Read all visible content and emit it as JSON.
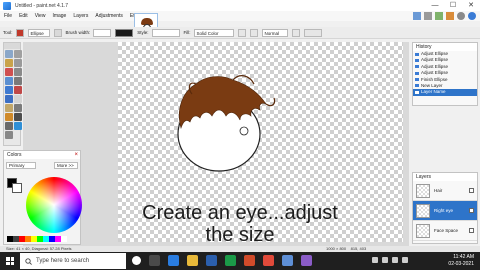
{
  "window": {
    "title": "Untitled - paint.net 4.1.7",
    "minimize": "—",
    "maximize": "☐",
    "close": "✕"
  },
  "menu": {
    "items": [
      "File",
      "Edit",
      "View",
      "Image",
      "Layers",
      "Adjustments",
      "Effects"
    ]
  },
  "toolbar": {
    "tool_label": "Tool:",
    "shape_value": "Ellipse",
    "brush_width_label": "Brush width:",
    "style_label": "Style:",
    "fill_label": "Fill:",
    "fill_value": "Solid Color",
    "blend_value": "Normal"
  },
  "colors_panel": {
    "title": "Colors",
    "mode": "Primary",
    "more_button": "More >>",
    "primary_color": "#000000",
    "secondary_color": "#ffffff",
    "palette": [
      "#000000",
      "#404040",
      "#ff0000",
      "#ff8000",
      "#ffff00",
      "#00ff00",
      "#00ffff",
      "#0000ff",
      "#ff00ff",
      "#ffffff"
    ]
  },
  "canvas": {
    "caption_line1": "Create an eye...adjust",
    "caption_line2": "the size",
    "hair_color": "#7a3b12"
  },
  "status": {
    "left": "Size: 41 × 40, Diagonal: 57.28 Pixels",
    "dimensions": "1000 × 800",
    "position": "815, 403"
  },
  "history": {
    "title": "History",
    "items": [
      {
        "label": "Adjust Ellipse",
        "selected": false
      },
      {
        "label": "Adjust Ellipse",
        "selected": false
      },
      {
        "label": "Adjust Ellipse",
        "selected": false
      },
      {
        "label": "Adjust Ellipse",
        "selected": false
      },
      {
        "label": "Finish Ellipse",
        "selected": false
      },
      {
        "label": "New Layer",
        "selected": false
      },
      {
        "label": "Layer Name",
        "selected": true
      }
    ]
  },
  "layers": {
    "title": "Layers",
    "items": [
      {
        "label": "Hair",
        "selected": false
      },
      {
        "label": "Right eye",
        "selected": true
      },
      {
        "label": "Face Space",
        "selected": false
      }
    ]
  },
  "taskbar": {
    "search_placeholder": "Type here to search",
    "time": "11:42 AM",
    "date": "02-03-2021"
  }
}
